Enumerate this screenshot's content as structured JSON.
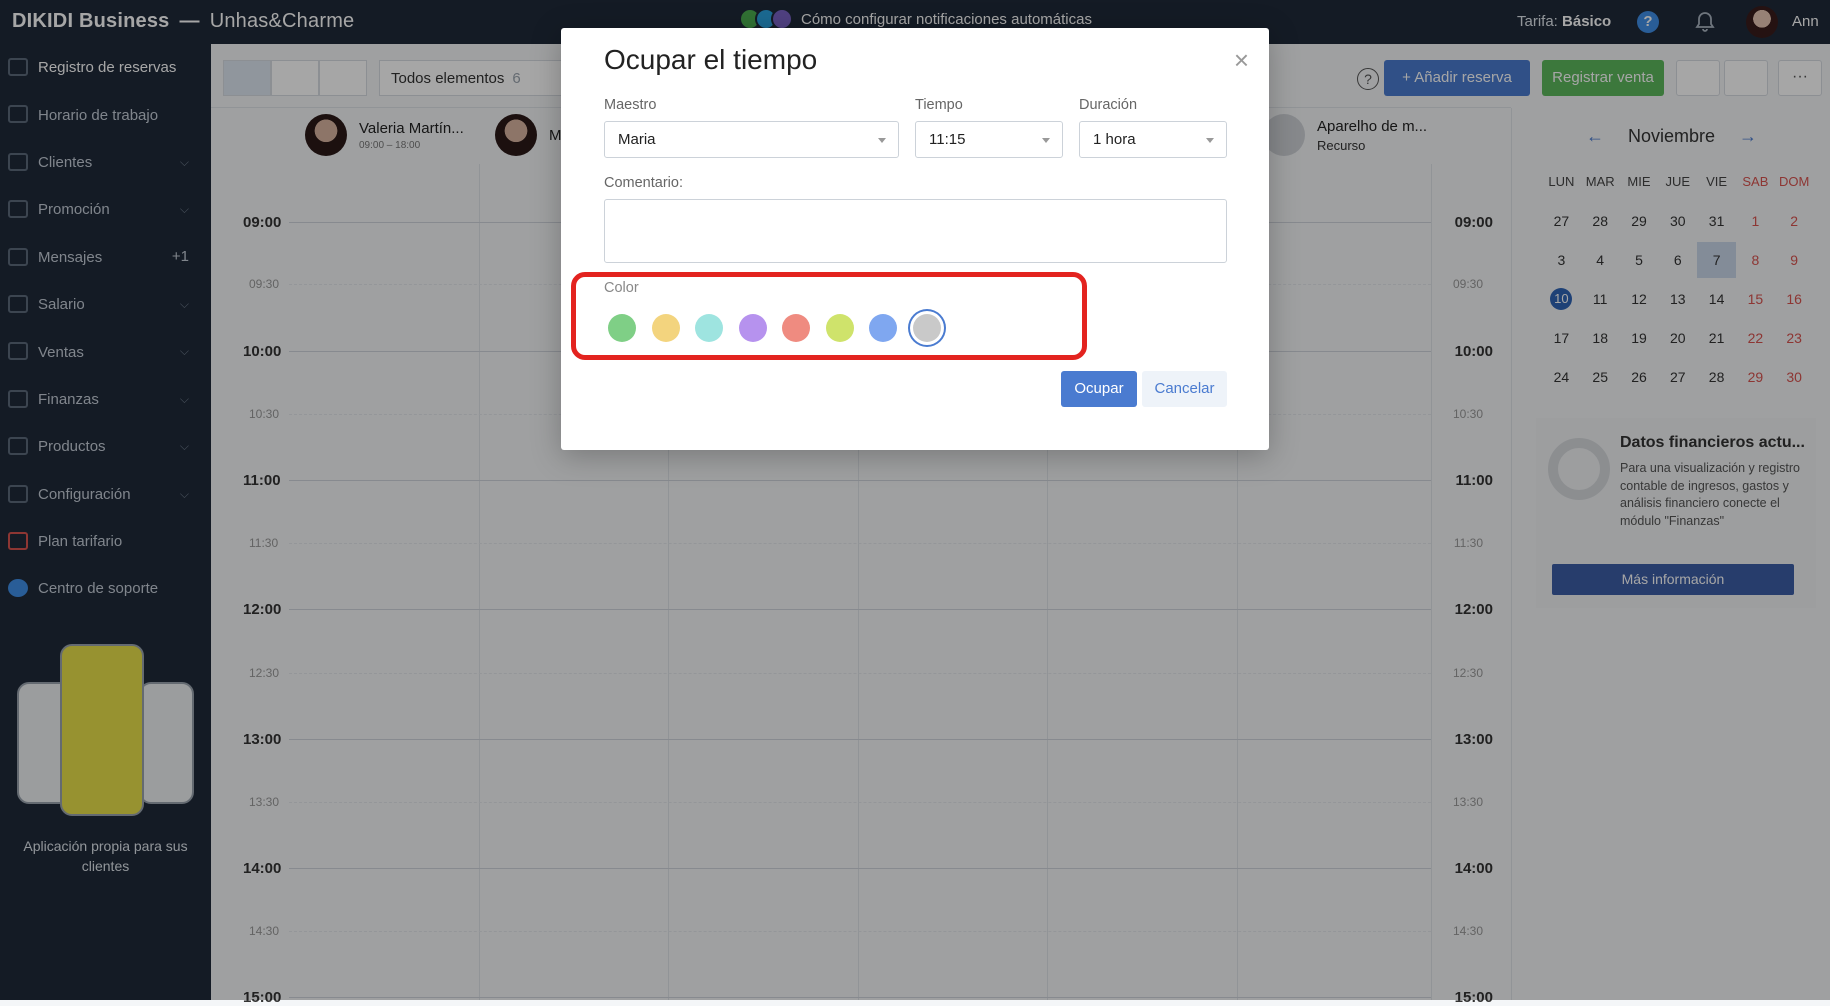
{
  "topbar": {
    "brand": "DIKIDI Business",
    "separator": "—",
    "salon": "Unhas&Charme",
    "notification": "Cómo configurar notificaciones automáticas",
    "tariff_label": "Tarifa:",
    "tariff_value": "Básico",
    "help": "?",
    "user": "Ann"
  },
  "sidebar": {
    "items": [
      {
        "label": "Registro de reservas"
      },
      {
        "label": "Horario de trabajo"
      },
      {
        "label": "Clientes"
      },
      {
        "label": "Promoción"
      },
      {
        "label": "Mensajes",
        "badge": "+1"
      },
      {
        "label": "Salario"
      },
      {
        "label": "Ventas"
      },
      {
        "label": "Finanzas"
      },
      {
        "label": "Productos"
      },
      {
        "label": "Configuración"
      },
      {
        "label": "Plan tarifario"
      },
      {
        "label": "Centro de soporte"
      }
    ],
    "promo_text": "Aplicación propia para sus clientes"
  },
  "toolbar": {
    "filter_label": "Todos elementos",
    "filter_count": "6",
    "help": "?",
    "add_booking": "Añadir reserva",
    "register_sale": "Registrar venta",
    "more": "···"
  },
  "staff": [
    {
      "name": "Valeria Martín...",
      "hours": "09:00 – 18:00"
    },
    {
      "name": "M"
    },
    {
      "name": "Aparelho de m...",
      "hours": "Recurso"
    }
  ],
  "schedule": {
    "hours": [
      "09:00",
      "10:00",
      "11:00",
      "12:00",
      "13:00",
      "14:00",
      "15:00"
    ],
    "half_hours": [
      "09:30",
      "10:30",
      "11:30",
      "12:30",
      "13:30",
      "14:30"
    ]
  },
  "calendar": {
    "month": "Noviembre",
    "prev_arrow": "←",
    "next_arrow": "→",
    "weekdays": [
      "LUN",
      "MAR",
      "MIE",
      "JUE",
      "VIE",
      "SAB",
      "DOM"
    ],
    "weeks": [
      [
        "27",
        "28",
        "29",
        "30",
        "31",
        "1",
        "2"
      ],
      [
        "3",
        "4",
        "5",
        "6",
        "7",
        "8",
        "9"
      ],
      [
        "10",
        "11",
        "12",
        "13",
        "14",
        "15",
        "16"
      ],
      [
        "17",
        "18",
        "19",
        "20",
        "21",
        "22",
        "23"
      ],
      [
        "24",
        "25",
        "26",
        "27",
        "28",
        "29",
        "30"
      ]
    ],
    "selected_day": "7",
    "today": "10"
  },
  "finance": {
    "title": "Datos financieros actu...",
    "description": "Para una visualización y registro contable de ingresos, gastos y análisis financiero conecte el módulo \"Finanzas\"",
    "button": "Más información"
  },
  "modal": {
    "title": "Ocupar el tiempo",
    "close": "×",
    "master_label": "Maestro",
    "master_value": "Maria",
    "time_label": "Tiempo",
    "time_value": "11:15",
    "duration_label": "Duración",
    "duration_value": "1 hora",
    "comment_label": "Comentario:",
    "color_label": "Color",
    "colors": [
      "#7fcf86",
      "#f3d47e",
      "#9ee4e0",
      "#b692ee",
      "#ef8b80",
      "#cfe36b",
      "#7fa7f0",
      "#c9c9c9"
    ],
    "selected_color_index": 7,
    "ok": "Ocupar",
    "cancel": "Cancelar"
  },
  "colors": {
    "topbar_bg": "#1f2a3a",
    "accent_blue": "#4a7bd0",
    "sale_green": "#5cb85c",
    "highlight_red": "#e3231f",
    "weekend_red": "#d9534f"
  }
}
